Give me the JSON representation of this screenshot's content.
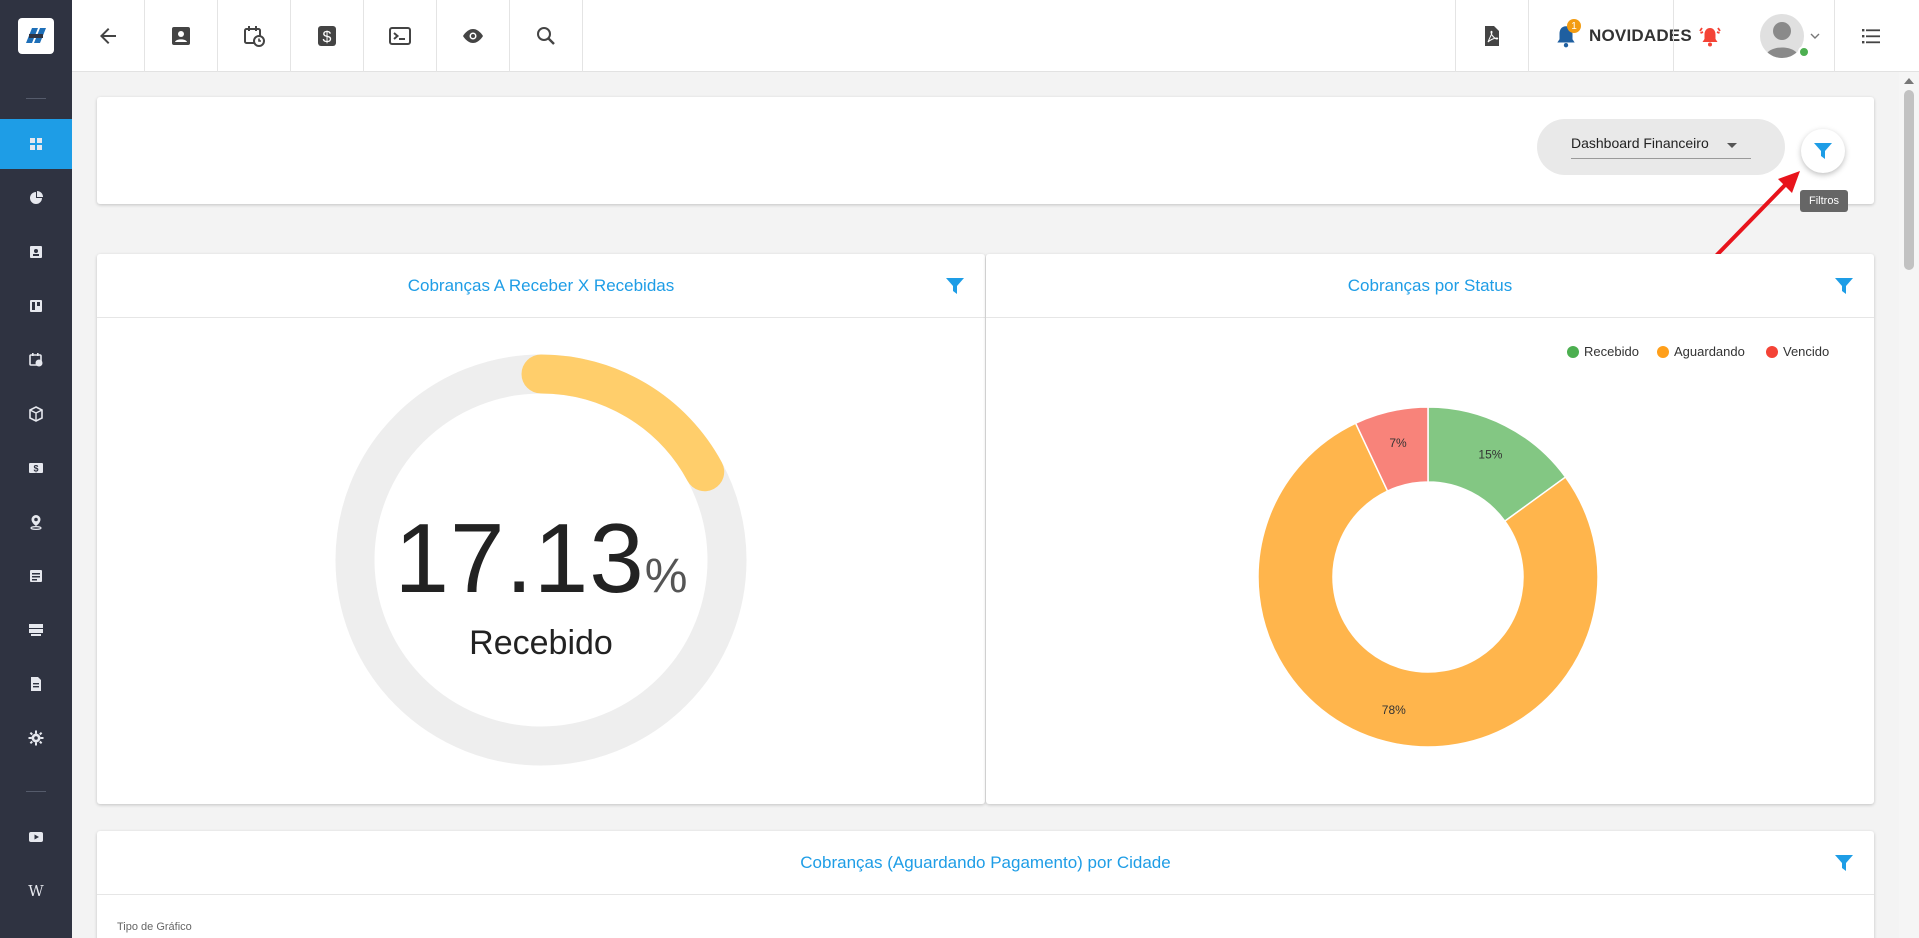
{
  "brand": {
    "accent": "#1e9de6",
    "sidebar_bg": "#2f3341"
  },
  "sidebar": {
    "items": [
      {
        "icon": "dashboard-icon",
        "active": true
      },
      {
        "icon": "pie-chart-icon"
      },
      {
        "icon": "contact-card-icon"
      },
      {
        "icon": "board-icon"
      },
      {
        "icon": "calendar-clock-icon"
      },
      {
        "icon": "box-icon"
      },
      {
        "icon": "money-icon"
      },
      {
        "icon": "map-pin-icon"
      },
      {
        "icon": "list-icon"
      },
      {
        "icon": "server-icon"
      },
      {
        "icon": "document-icon"
      },
      {
        "icon": "gear-icon"
      }
    ],
    "bottom": [
      {
        "icon": "youtube-icon"
      },
      {
        "icon": "wiki-icon",
        "label": "W"
      }
    ]
  },
  "topbar": {
    "left_icons": [
      "back-arrow-icon",
      "contact-icon",
      "calendar-clock-icon",
      "dollar-icon",
      "terminal-icon",
      "eye-icon",
      "search-icon"
    ],
    "right": {
      "pdf_icon": "pdf-icon",
      "novidades_label": "NOVIDADES",
      "notification_count": "1",
      "alarm_icon": "alarm-bell-icon",
      "menu_icon": "list-menu-icon"
    }
  },
  "header_card": {
    "dashboard_select_value": "Dashboard Financeiro",
    "filter_tooltip": "Filtros"
  },
  "gauge_card": {
    "title": "Cobranças A Receber X Recebidas",
    "value": "17.13",
    "unit": "%",
    "label": "Recebido",
    "fraction": 0.1713,
    "arc_color": "#ffce6b",
    "track_color": "#eeeeee"
  },
  "status_card": {
    "title": "Cobranças por Status",
    "legend": [
      {
        "name": "Recebido",
        "color": "#4caf50"
      },
      {
        "name": "Aguardando",
        "color": "#ff9f1a"
      },
      {
        "name": "Vencido",
        "color": "#f44336"
      }
    ]
  },
  "chart_data": {
    "type": "pie",
    "title": "Cobranças por Status",
    "donut": true,
    "categories": [
      "Recebido",
      "Aguardando",
      "Vencido"
    ],
    "values": [
      15,
      78,
      7
    ],
    "labels": [
      "15%",
      "78%",
      "7%"
    ],
    "colors": [
      "#83c783",
      "#ffb54c",
      "#f8837a"
    ],
    "legend": "top-right"
  },
  "city_card": {
    "title": "Cobranças (Aguardando Pagamento) por Cidade",
    "chart_type_label": "Tipo de Gráfico"
  }
}
